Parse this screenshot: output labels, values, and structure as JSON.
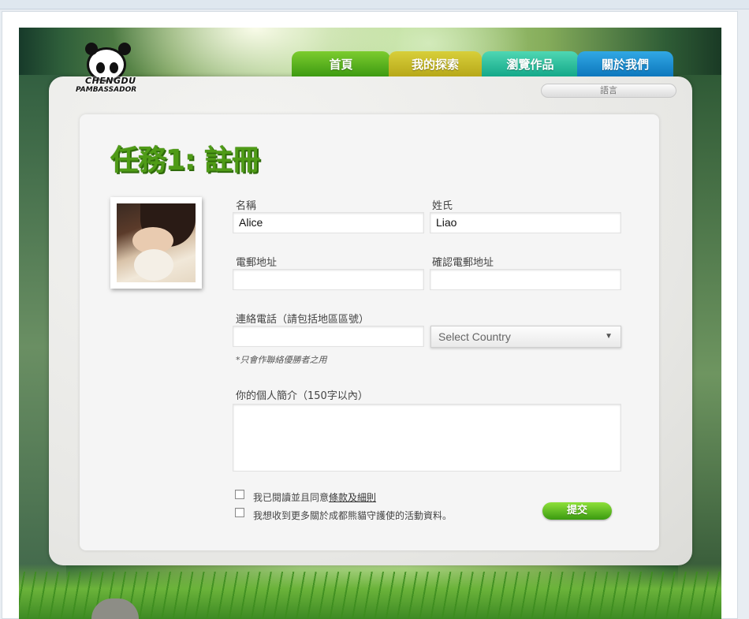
{
  "logo": {
    "line1": "CHENGDU",
    "line2": "PAMBASSADOR"
  },
  "nav": {
    "tabs": [
      {
        "label": "首頁",
        "color": "#52ad1c"
      },
      {
        "label": "我的探索",
        "color": "#c8bb24"
      },
      {
        "label": "瀏覽作品",
        "color": "#22bf9c"
      },
      {
        "label": "關於我們",
        "color": "#1a8ccf"
      }
    ]
  },
  "language": {
    "label": "語言"
  },
  "form": {
    "title": "任務1: 註冊",
    "first_name": {
      "label": "名稱",
      "value": "Alice"
    },
    "last_name": {
      "label": "姓氏",
      "value": "Liao"
    },
    "email": {
      "label": "電郵地址",
      "value": ""
    },
    "confirm_email": {
      "label": "確認電郵地址",
      "value": ""
    },
    "phone": {
      "label": "連絡電話（請包括地區區號）",
      "value": ""
    },
    "country": {
      "selected": "Select Country"
    },
    "phone_note": "*只會作聯絡優勝者之用",
    "bio": {
      "label": "你的個人簡介（150字以內）",
      "value": ""
    },
    "agree_terms": {
      "prefix": "我已閱讀並且同意",
      "link": "條款及細則",
      "checked": false
    },
    "subscribe": {
      "label": "我想收到更多關於成都熊貓守護使的活動資料。",
      "checked": false
    },
    "submit_label": "提交"
  },
  "colors": {
    "accent_green": "#4f9b17",
    "submit_green": "#5fbf22"
  }
}
